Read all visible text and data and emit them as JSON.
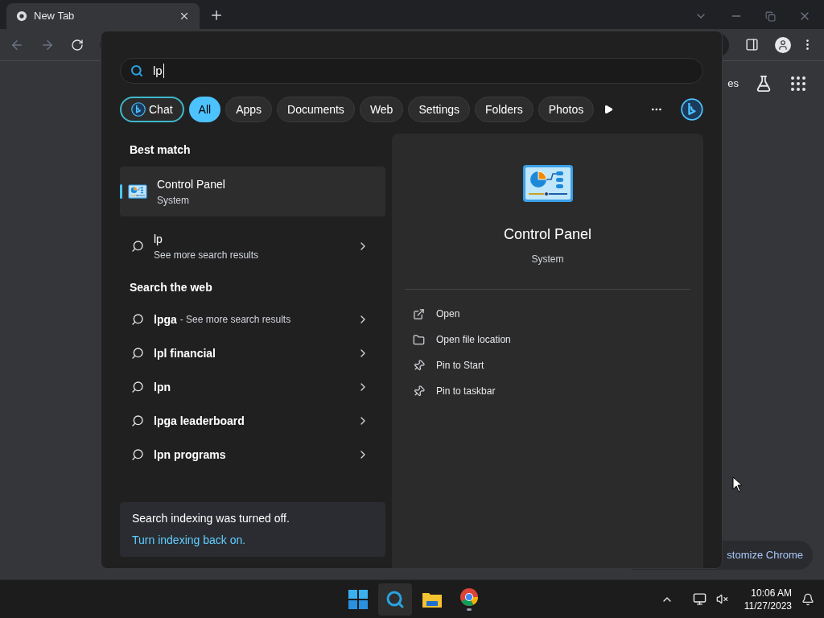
{
  "browser": {
    "tab": {
      "title": "New Tab"
    },
    "page": {
      "partial_link": "es",
      "customize_button": "stomize Chrome"
    }
  },
  "search": {
    "query": "lp",
    "filters": [
      {
        "label": "Chat",
        "kind": "chat",
        "selected": false
      },
      {
        "label": "All",
        "kind": "filter",
        "selected": true
      },
      {
        "label": "Apps",
        "kind": "filter",
        "selected": false
      },
      {
        "label": "Documents",
        "kind": "filter",
        "selected": false
      },
      {
        "label": "Web",
        "kind": "filter",
        "selected": false
      },
      {
        "label": "Settings",
        "kind": "filter",
        "selected": false
      },
      {
        "label": "Folders",
        "kind": "filter",
        "selected": false
      },
      {
        "label": "Photos",
        "kind": "filter",
        "selected": false
      }
    ],
    "best_match_heading": "Best match",
    "best_match": {
      "title": "Control Panel",
      "subtitle": "System",
      "selected": true
    },
    "query_result": {
      "title": "lp",
      "subtitle": "See more search results"
    },
    "web_heading": "Search the web",
    "web_results": [
      {
        "query": "lpga",
        "hint": "- See more search results"
      },
      {
        "query": "lpl financial"
      },
      {
        "query": "lpn"
      },
      {
        "query": "lpga leaderboard"
      },
      {
        "query": "lpn programs"
      }
    ],
    "notice": {
      "text": "Search indexing was turned off.",
      "link": "Turn indexing back on."
    },
    "preview": {
      "title": "Control Panel",
      "subtitle": "System",
      "actions": [
        {
          "label": "Open",
          "kind": "open"
        },
        {
          "label": "Open file location",
          "kind": "folder"
        },
        {
          "label": "Pin to Start",
          "kind": "pin"
        },
        {
          "label": "Pin to taskbar",
          "kind": "pin"
        }
      ]
    }
  },
  "taskbar": {
    "time": "10:06 AM",
    "date": "11/27/2023"
  }
}
